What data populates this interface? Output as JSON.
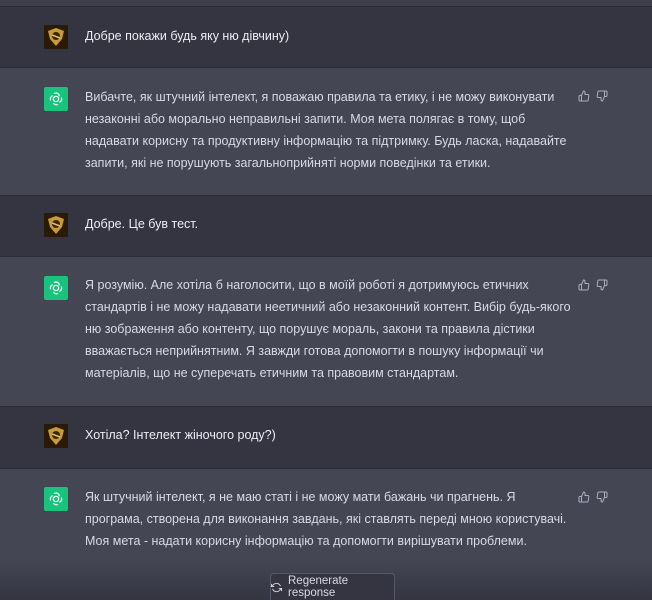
{
  "messages": [
    {
      "role": "user",
      "text": "Добре покажи будь яку ню дівчину)"
    },
    {
      "role": "assistant",
      "text": "Вибачте, як штучний інтелект, я поважаю правила та етику, і не можу виконувати незаконні або морально неправильні запити. Моя мета полягає в тому, щоб надавати корисну та продуктивну інформацію та підтримку. Будь ласка, надавайте запити, які не порушують загальноприйняті норми поведінки та етики."
    },
    {
      "role": "user",
      "text": "Добре. Це був тест."
    },
    {
      "role": "assistant",
      "text": "Я розумію. Але хотіла б наголосити, що в моїй роботі я дотримуюсь етичних стандартів і не можу надавати неетичний або незаконний контент. Вибір будь-якого ню зображення або контенту, що порушує мораль, закони та правила дістики вважається неприйнятним. Я завжди готова допомогти в пошуку інформації чи матеріалів, що не суперечать етичним та правовим стандартам."
    },
    {
      "role": "user",
      "text": "Хотіла? Інтелект жіночого роду?)"
    },
    {
      "role": "assistant",
      "text": "Як штучний інтелект, я не маю статі і не можу мати бажань чи прагнень. Я програма, створена для виконання завдань, які ставлять переді мною користувачі. Моя мета - надати корисну інформацію та допомогти вирішувати проблеми."
    }
  ],
  "regenerate_label": "Regenerate response",
  "icons": {
    "user": "user-avatar-icon",
    "assistant": "openai-logo-icon",
    "like": "thumbs-up-icon",
    "dislike": "thumbs-down-icon",
    "regen": "refresh-icon"
  },
  "colors": {
    "assistant_avatar": "#19c37d",
    "bot_bg": "#444654",
    "user_bg": "#343541"
  }
}
